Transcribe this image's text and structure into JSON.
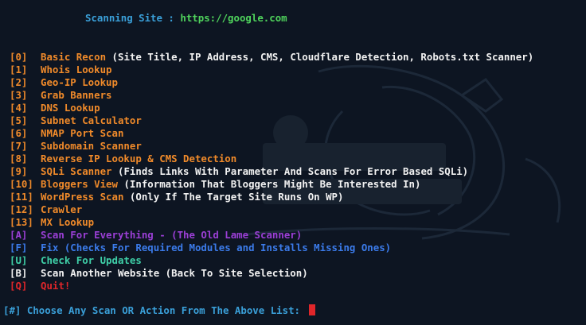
{
  "header": {
    "label": "Scanning Site : ",
    "url": "https://google.com"
  },
  "menu": [
    {
      "key": "[0]",
      "title": "Basic Recon",
      "desc": " (Site Title, IP Address, CMS, Cloudflare Detection, Robots.txt Scanner)"
    },
    {
      "key": "[1]",
      "title": "Whois Lookup",
      "desc": ""
    },
    {
      "key": "[2]",
      "title": "Geo-IP Lookup",
      "desc": ""
    },
    {
      "key": "[3]",
      "title": "Grab Banners",
      "desc": ""
    },
    {
      "key": "[4]",
      "title": "DNS Lookup",
      "desc": ""
    },
    {
      "key": "[5]",
      "title": "Subnet Calculator",
      "desc": ""
    },
    {
      "key": "[6]",
      "title": "NMAP Port Scan",
      "desc": ""
    },
    {
      "key": "[7]",
      "title": "Subdomain Scanner",
      "desc": ""
    },
    {
      "key": "[8]",
      "title": "Reverse IP Lookup & CMS Detection",
      "desc": ""
    },
    {
      "key": "[9]",
      "title": "SQLi Scanner",
      "desc": " (Finds Links With Parameter And Scans For Error Based SQLi)"
    },
    {
      "key": "[10]",
      "title": "Bloggers View",
      "desc": " (Information That Bloggers Might Be Interested In)"
    },
    {
      "key": "[11]",
      "title": "WordPress Scan",
      "desc": " (Only If The Target Site Runs On WP)"
    },
    {
      "key": "[12]",
      "title": "Crawler",
      "desc": ""
    },
    {
      "key": "[13]",
      "title": "MX Lookup",
      "desc": ""
    },
    {
      "key": "[A]",
      "title": "Scan For Everything - (The Old Lame Scanner)",
      "desc": ""
    },
    {
      "key": "[F]",
      "title": "Fix (Checks For Required Modules and Installs Missing Ones)",
      "desc": ""
    },
    {
      "key": "[U]",
      "title": "Check For Updates",
      "desc": ""
    },
    {
      "key": "[B]",
      "title": "Scan Another Website (Back To Site Selection)",
      "desc": ""
    },
    {
      "key": "[Q]",
      "title": "Quit!",
      "desc": ""
    }
  ],
  "prompt": {
    "text": "[#] Choose Any Scan OR Action From The Above List: "
  },
  "colors": {
    "background": "#0d1522",
    "header_label": "#3a9fd8",
    "header_url": "#4fd35c",
    "numbered_key": "#f08a2a",
    "numbered_title": "#f08a2a",
    "description": "#f2f2f2",
    "scan_everything": "#9b3fd6",
    "fix": "#3b7bea",
    "updates": "#3fd0a8",
    "back": "#f2f2f2",
    "quit": "#e0262a",
    "cursor": "#e0262a"
  }
}
